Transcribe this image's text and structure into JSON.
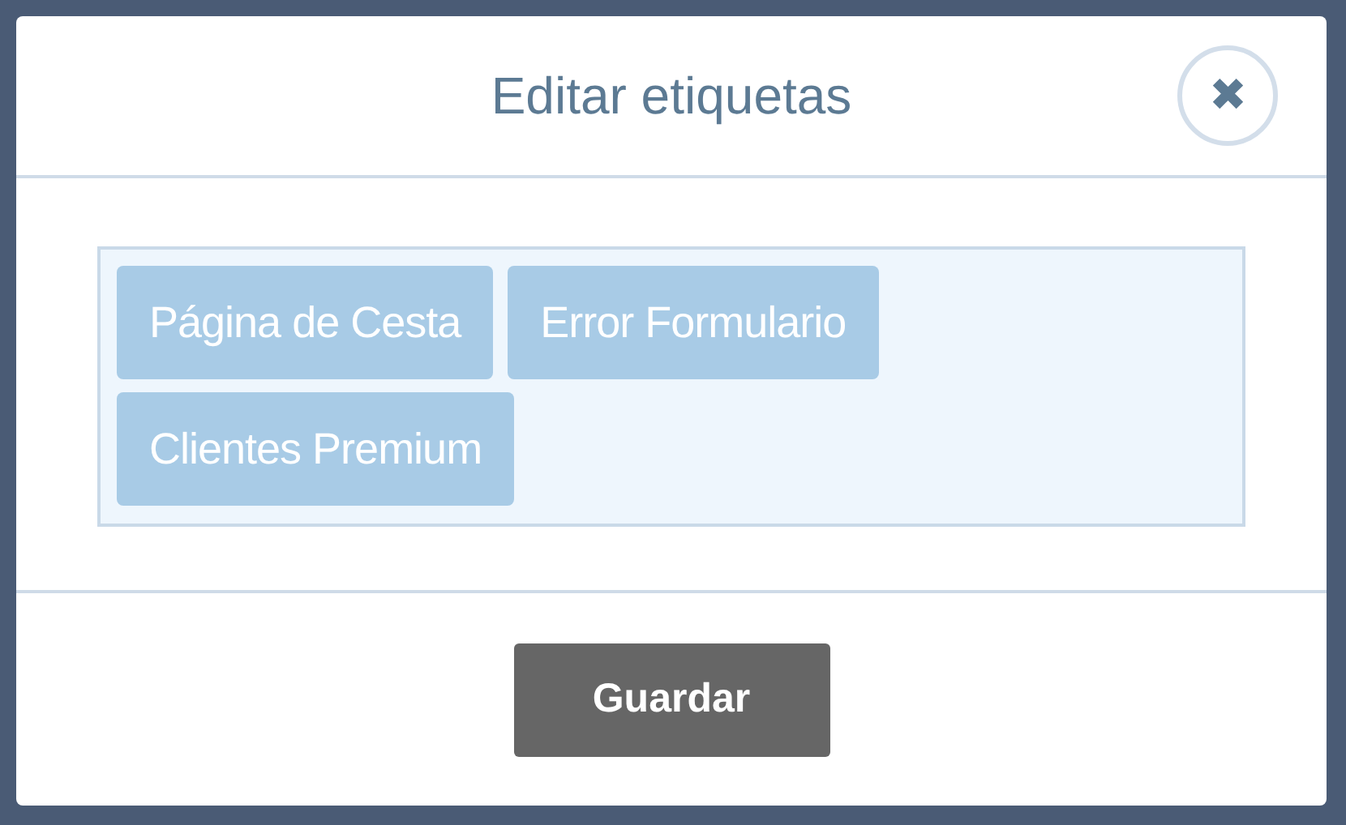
{
  "dialog": {
    "title": "Editar etiquetas",
    "close_icon": "✖"
  },
  "tags": [
    {
      "label": "Página de Cesta"
    },
    {
      "label": "Error Formulario"
    },
    {
      "label": "Clientes Premium"
    }
  ],
  "buttons": [
    {
      "label": "Guardar"
    }
  ]
}
